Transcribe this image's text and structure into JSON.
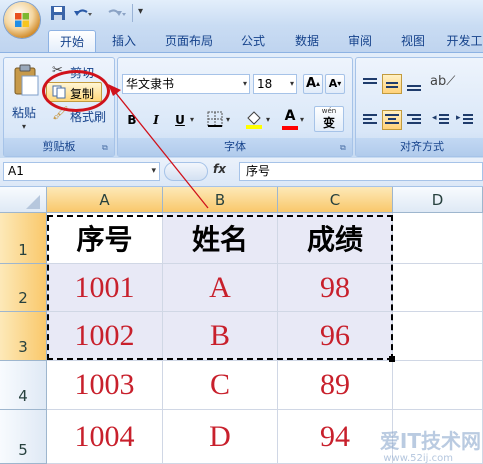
{
  "ribbon_tabs": [
    "开始",
    "插入",
    "页面布局",
    "公式",
    "数据",
    "审阅",
    "视图",
    "开发工"
  ],
  "clipboard": {
    "cut_label": "剪切",
    "copy_label": "复制",
    "format_painter_label": "格式刷",
    "paste_label": "粘贴",
    "group_label": "剪贴板"
  },
  "font": {
    "family": "华文隶书",
    "size": "18",
    "grow_label": "A",
    "shrink_label": "A",
    "bold": "B",
    "italic": "I",
    "underline": "U",
    "color_label": "A",
    "phonetic_label": "wén",
    "phonetic_char": "变",
    "group_label": "字体"
  },
  "alignment": {
    "group_label": "对齐方式"
  },
  "formula_bar": {
    "name_box": "A1",
    "fx_label": "fx",
    "content": "序号"
  },
  "sheet": {
    "columns": [
      "A",
      "B",
      "C",
      "D"
    ],
    "rows": [
      "1",
      "2",
      "3",
      "4",
      "5"
    ],
    "header": [
      "序号",
      "姓名",
      "成绩"
    ],
    "data": [
      [
        "1001",
        "A",
        "98"
      ],
      [
        "1002",
        "B",
        "96"
      ],
      [
        "1003",
        "C",
        "89"
      ],
      [
        "1004",
        "D",
        "94"
      ]
    ]
  },
  "colors": {
    "ribbon_bg": "#d6e5f7",
    "selected_header": "#f9c86b",
    "data_text": "#c8202c",
    "callout": "#d0121b"
  },
  "watermark": {
    "main": "爱IT技术网",
    "sub": "www.52ij.com"
  }
}
